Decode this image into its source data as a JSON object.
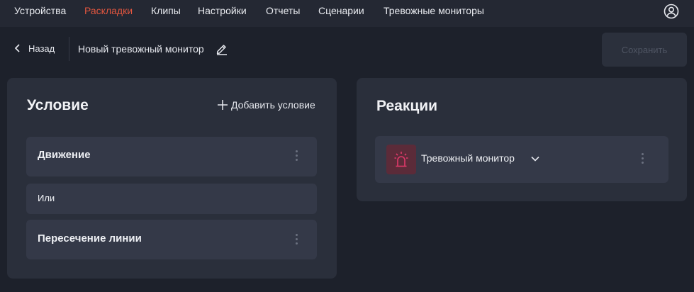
{
  "nav": {
    "items": [
      {
        "label": "Устройства",
        "active": false
      },
      {
        "label": "Раскладки",
        "active": true
      },
      {
        "label": "Клипы",
        "active": false
      },
      {
        "label": "Настройки",
        "active": false
      },
      {
        "label": "Отчеты",
        "active": false
      },
      {
        "label": "Сценарии",
        "active": false
      },
      {
        "label": "Тревожные мониторы",
        "active": false
      }
    ],
    "profile_icon": "user-circle-icon"
  },
  "header": {
    "back_label": "Назад",
    "monitor_name": "Новый тревожный монитор",
    "edit_icon": "pencil-icon",
    "save_label": "Сохранить"
  },
  "conditions": {
    "title": "Условие",
    "add_label": "Добавить условие",
    "items": [
      {
        "label": "Движение"
      },
      {
        "label": "Или"
      },
      {
        "label": "Пересечение линии"
      }
    ]
  },
  "reactions": {
    "title": "Реакции",
    "items": [
      {
        "label": "Тревожный монитор",
        "icon": "alarm-siren-icon"
      }
    ]
  },
  "colors": {
    "accent": "#e2563f",
    "background": "#1d212b",
    "panel": "#2a2f3b",
    "row": "#343948",
    "alarm": "#e0396a"
  }
}
